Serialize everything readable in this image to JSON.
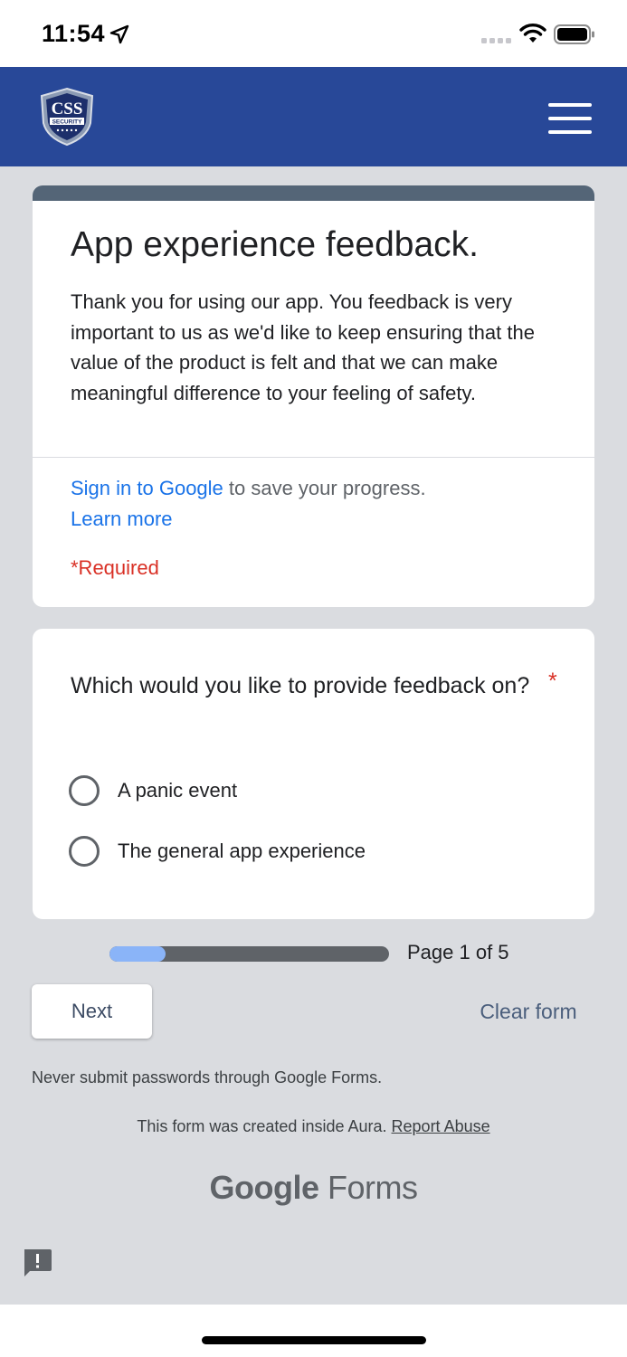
{
  "status_bar": {
    "time": "11:54",
    "icons": [
      "location-arrow-icon",
      "cellular-signal-icon",
      "wifi-icon",
      "battery-icon"
    ]
  },
  "header": {
    "logo_text": "CSS",
    "logo_subtext": "SECURITY",
    "background": "#284898",
    "menu_icon": "hamburger-menu-icon"
  },
  "form": {
    "title": "App experience feedback.",
    "description": "Thank you for using our app. You feedback is very important to us as we'd like to keep ensuring that the value of the product is felt and that we can make meaningful difference to your feeling of safety.",
    "signin_link": "Sign in to Google",
    "signin_suffix": " to save your progress.",
    "learn_more": "Learn more",
    "required_note": "*Required"
  },
  "question": {
    "text": "Which would you like to provide feedback on?",
    "required_marker": "*",
    "options": [
      {
        "label": "A panic event",
        "selected": false
      },
      {
        "label": "The general app experience",
        "selected": false
      }
    ]
  },
  "progress": {
    "current_page": 1,
    "total_pages": 5,
    "label": "Page 1 of 5",
    "fill_fraction": 0.2
  },
  "actions": {
    "next_label": "Next",
    "clear_label": "Clear form"
  },
  "footer": {
    "password_warning": "Never submit passwords through Google Forms.",
    "created_text": "This form was created inside Aura.",
    "report_link": "Report Abuse",
    "brand_google": "Google",
    "brand_forms": "Forms"
  },
  "colors": {
    "accent_bar": "#546577",
    "link": "#1a73e8",
    "required": "#d93025",
    "progress_fill": "#8ab4f8",
    "page_background": "#dadce0"
  }
}
